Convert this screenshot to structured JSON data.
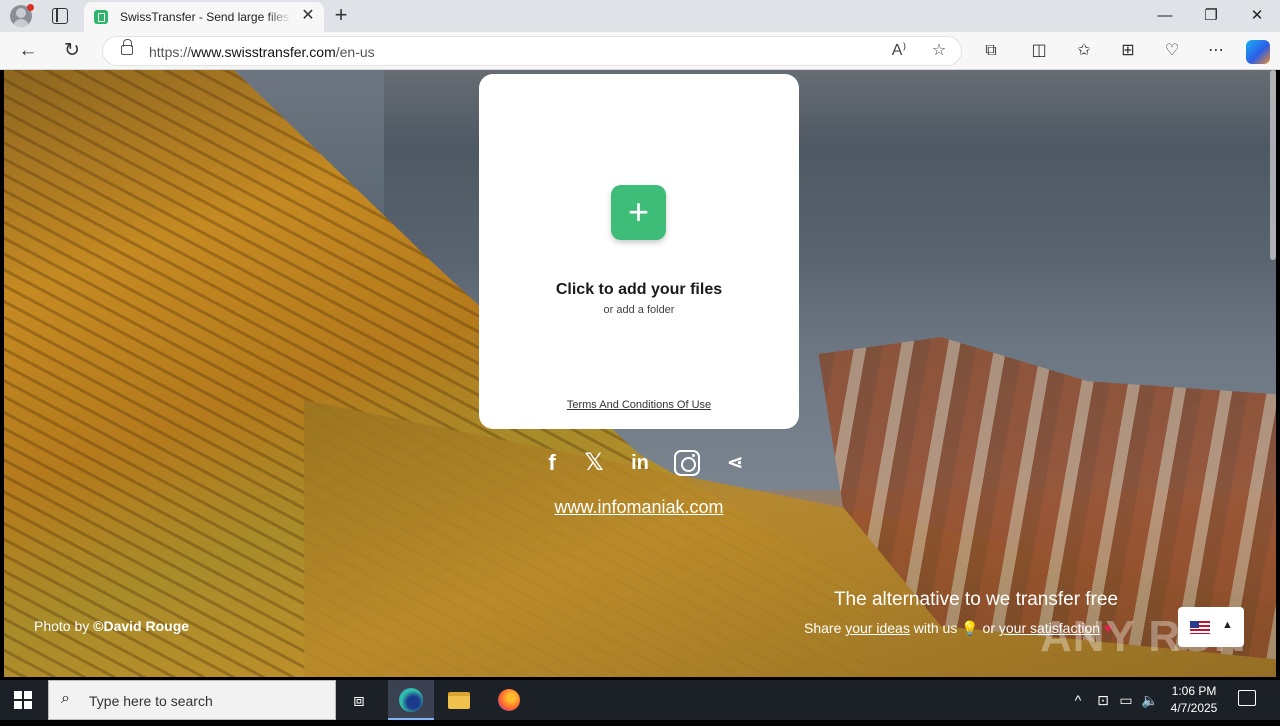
{
  "browser": {
    "tab_title": "SwissTransfer - Send large files se",
    "tab_close": "✕",
    "new_tab": "+",
    "url_prefix": "https://",
    "url_domain": "www.swisstransfer.com",
    "url_path": "/en-us",
    "window_controls": {
      "minimize": "—",
      "maximize": "❐",
      "close": "✕"
    },
    "icons": [
      "back-icon",
      "refresh-icon",
      "lock-icon",
      "read-aloud-icon",
      "favorite-star-icon",
      "extensions-icon",
      "split-screen-icon",
      "favorites-icon",
      "collections-icon",
      "browser-essentials-icon",
      "more-icon",
      "copilot-icon"
    ]
  },
  "page": {
    "upload_card": {
      "add_symbol": "+",
      "title": "Click to add your files",
      "subtitle": "or add a folder",
      "terms_link": "Terms And Conditions Of Use"
    },
    "social": {
      "facebook": "f",
      "x": "𝕏",
      "linkedin": "in",
      "share": "⋖"
    },
    "infomaniak_link": "www.infomaniak.com",
    "photo_credit_prefix": "Photo by ",
    "photo_credit_author": "©David Rouge",
    "tagline": "The alternative to we transfer free",
    "share_prefix": "Share ",
    "share_ideas": "your ideas",
    "share_middle": " with us ",
    "share_or": " or ",
    "share_satisfaction": "your satisfaction",
    "bulb": "💡",
    "heart": "♥",
    "language_caret": "▲",
    "watermark": "ANY RUN"
  },
  "taskbar": {
    "search_placeholder": "Type here to search",
    "time": "1:06 PM",
    "date": "4/7/2025",
    "tray_chevron": "^"
  }
}
